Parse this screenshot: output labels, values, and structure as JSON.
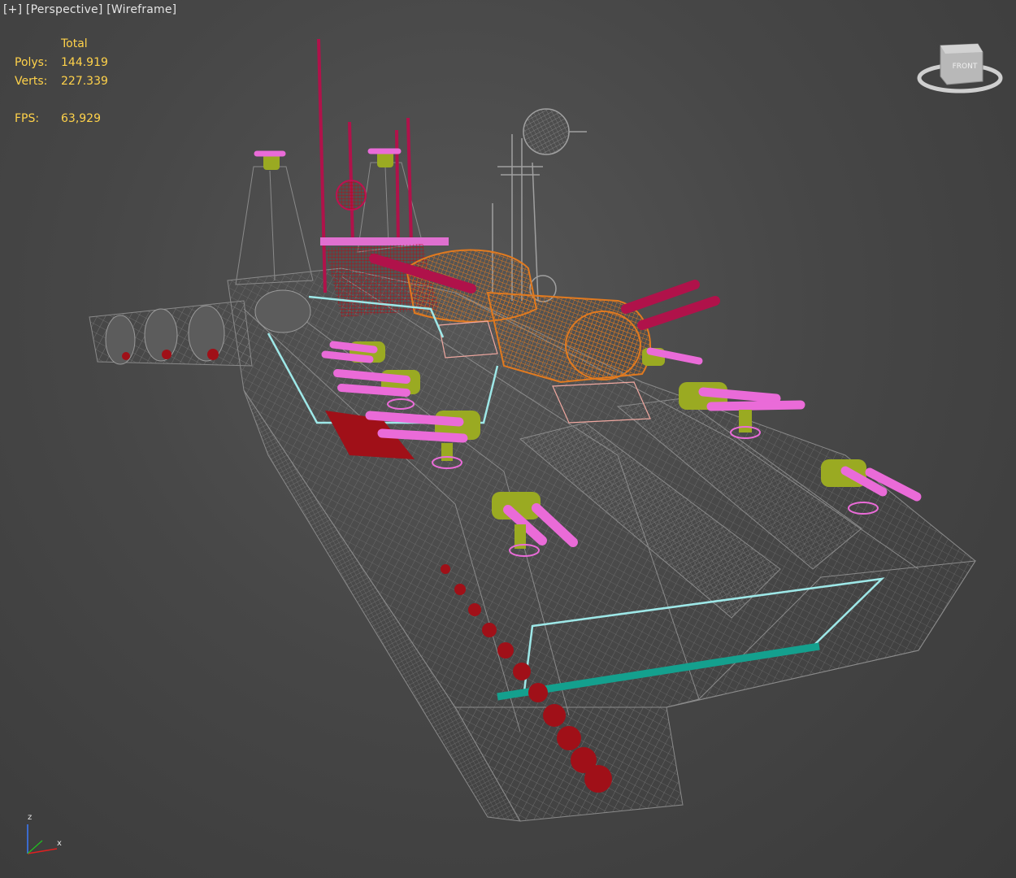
{
  "viewport": {
    "plus_label": "[+]",
    "view_label": "[Perspective]",
    "shading_label": "[Wireframe]"
  },
  "stats": {
    "header": "Total",
    "polys_label": "Polys:",
    "polys_value": "144.919",
    "verts_label": "Verts:",
    "verts_value": "227.339",
    "fps_label": "FPS:",
    "fps_value": "63,929"
  },
  "viewcube": {
    "face_label": "FRONT"
  },
  "axis": {
    "z_label": "z",
    "x_label": "x"
  },
  "colors": {
    "hull_wire": "#8a8a8a",
    "red": "#a01018",
    "magenta": "#c01050",
    "orange": "#e07a20",
    "pink": "#ea6bd8",
    "olive": "#9aaa22",
    "cyan": "#9ee8e8",
    "teal": "#14a08e",
    "salmon": "#f0a8a0",
    "stats_text": "#ffd24a"
  }
}
